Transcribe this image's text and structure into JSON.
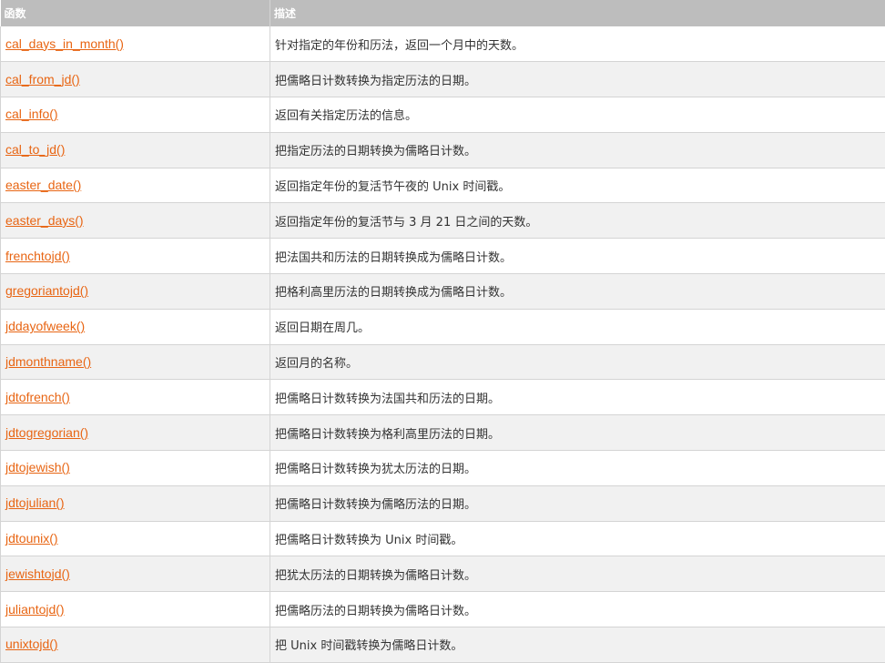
{
  "table": {
    "headers": [
      "函数",
      "描述"
    ],
    "rows": [
      {
        "fn": "cal_days_in_month()",
        "desc": "针对指定的年份和历法，返回一个月中的天数。"
      },
      {
        "fn": "cal_from_jd()",
        "desc": "把儒略日计数转换为指定历法的日期。"
      },
      {
        "fn": "cal_info()",
        "desc": "返回有关指定历法的信息。"
      },
      {
        "fn": "cal_to_jd()",
        "desc": "把指定历法的日期转换为儒略日计数。"
      },
      {
        "fn": "easter_date()",
        "desc": "返回指定年份的复活节午夜的 Unix 时间戳。"
      },
      {
        "fn": "easter_days()",
        "desc": "返回指定年份的复活节与 3 月 21 日之间的天数。"
      },
      {
        "fn": "frenchtojd()",
        "desc": "把法国共和历法的日期转换成为儒略日计数。"
      },
      {
        "fn": "gregoriantojd()",
        "desc": "把格利高里历法的日期转换成为儒略日计数。"
      },
      {
        "fn": "jddayofweek()",
        "desc": "返回日期在周几。"
      },
      {
        "fn": "jdmonthname()",
        "desc": "返回月的名称。"
      },
      {
        "fn": "jdtofrench()",
        "desc": "把儒略日计数转换为法国共和历法的日期。"
      },
      {
        "fn": "jdtogregorian()",
        "desc": "把儒略日计数转换为格利高里历法的日期。"
      },
      {
        "fn": "jdtojewish()",
        "desc": "把儒略日计数转换为犹太历法的日期。"
      },
      {
        "fn": "jdtojulian()",
        "desc": "把儒略日计数转换为儒略历法的日期。"
      },
      {
        "fn": "jdtounix()",
        "desc": "把儒略日计数转换为 Unix 时间戳。"
      },
      {
        "fn": "jewishtojd()",
        "desc": "把犹太历法的日期转换为儒略日计数。"
      },
      {
        "fn": "juliantojd()",
        "desc": "把儒略历法的日期转换为儒略日计数。"
      },
      {
        "fn": "unixtojd()",
        "desc": "把 Unix 时间戳转换为儒略日计数。"
      }
    ]
  },
  "colors": {
    "header_bg": "#bdbdbd",
    "link": "#e86513",
    "alt_row": "#f1f1f1",
    "border": "#d4d4d4"
  }
}
